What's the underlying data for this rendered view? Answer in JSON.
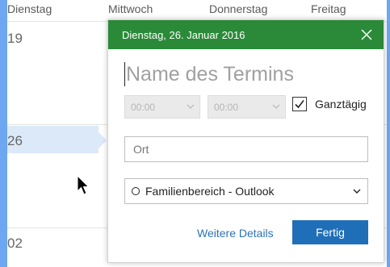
{
  "calendar": {
    "day_headers": [
      "Dienstag",
      "Mittwoch",
      "Donnerstag",
      "Freitag"
    ],
    "week_dates": [
      "19",
      "26",
      "02"
    ]
  },
  "event_popup": {
    "date_title": "Dienstag, 26. Januar 2016",
    "title_placeholder": "Name des Termins",
    "start_time": "00:00",
    "end_time": "00:00",
    "all_day_label": "Ganztägig",
    "all_day_checked": true,
    "location_placeholder": "Ort",
    "calendar_selected": "Familienbereich - Outlook",
    "more_details_label": "Weitere Details",
    "done_label": "Fertig"
  },
  "colors": {
    "header_green": "#2a8a38",
    "accent_blue": "#1f6fb8",
    "selected_day": "#dbe9f8"
  },
  "icons": {
    "close": "close-icon",
    "checkmark": "checkmark-icon",
    "dropdown": "chevron-down-icon",
    "calendar": "circle-icon",
    "pointer": "mouse-pointer-icon"
  }
}
